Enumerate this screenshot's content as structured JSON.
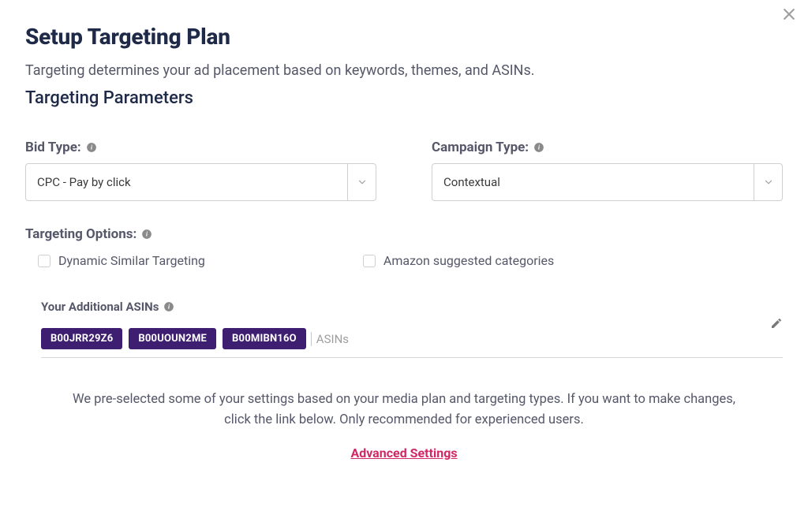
{
  "header": {
    "title": "Setup Targeting Plan",
    "description": "Targeting determines your ad placement based on keywords, themes, and ASINs.",
    "subheading": "Targeting Parameters"
  },
  "fields": {
    "bidType": {
      "label": "Bid Type:",
      "value": "CPC - Pay by click"
    },
    "campaignType": {
      "label": "Campaign Type:",
      "value": "Contextual"
    }
  },
  "targetingOptions": {
    "label": "Targeting Options:",
    "dynamicSimilar": "Dynamic Similar Targeting",
    "amazonSuggested": "Amazon suggested categories"
  },
  "asins": {
    "label": "Your Additional ASINs",
    "placeholder": "ASINs",
    "chips": [
      "B00JRR29Z6",
      "B00UOUN2ME",
      "B00MIBN16O"
    ]
  },
  "footer": {
    "preselectedText": "We pre-selected some of your settings based on your media plan and targeting types. If you want to make changes, click the link below. Only recommended for experienced users.",
    "advancedLink": "Advanced Settings"
  }
}
